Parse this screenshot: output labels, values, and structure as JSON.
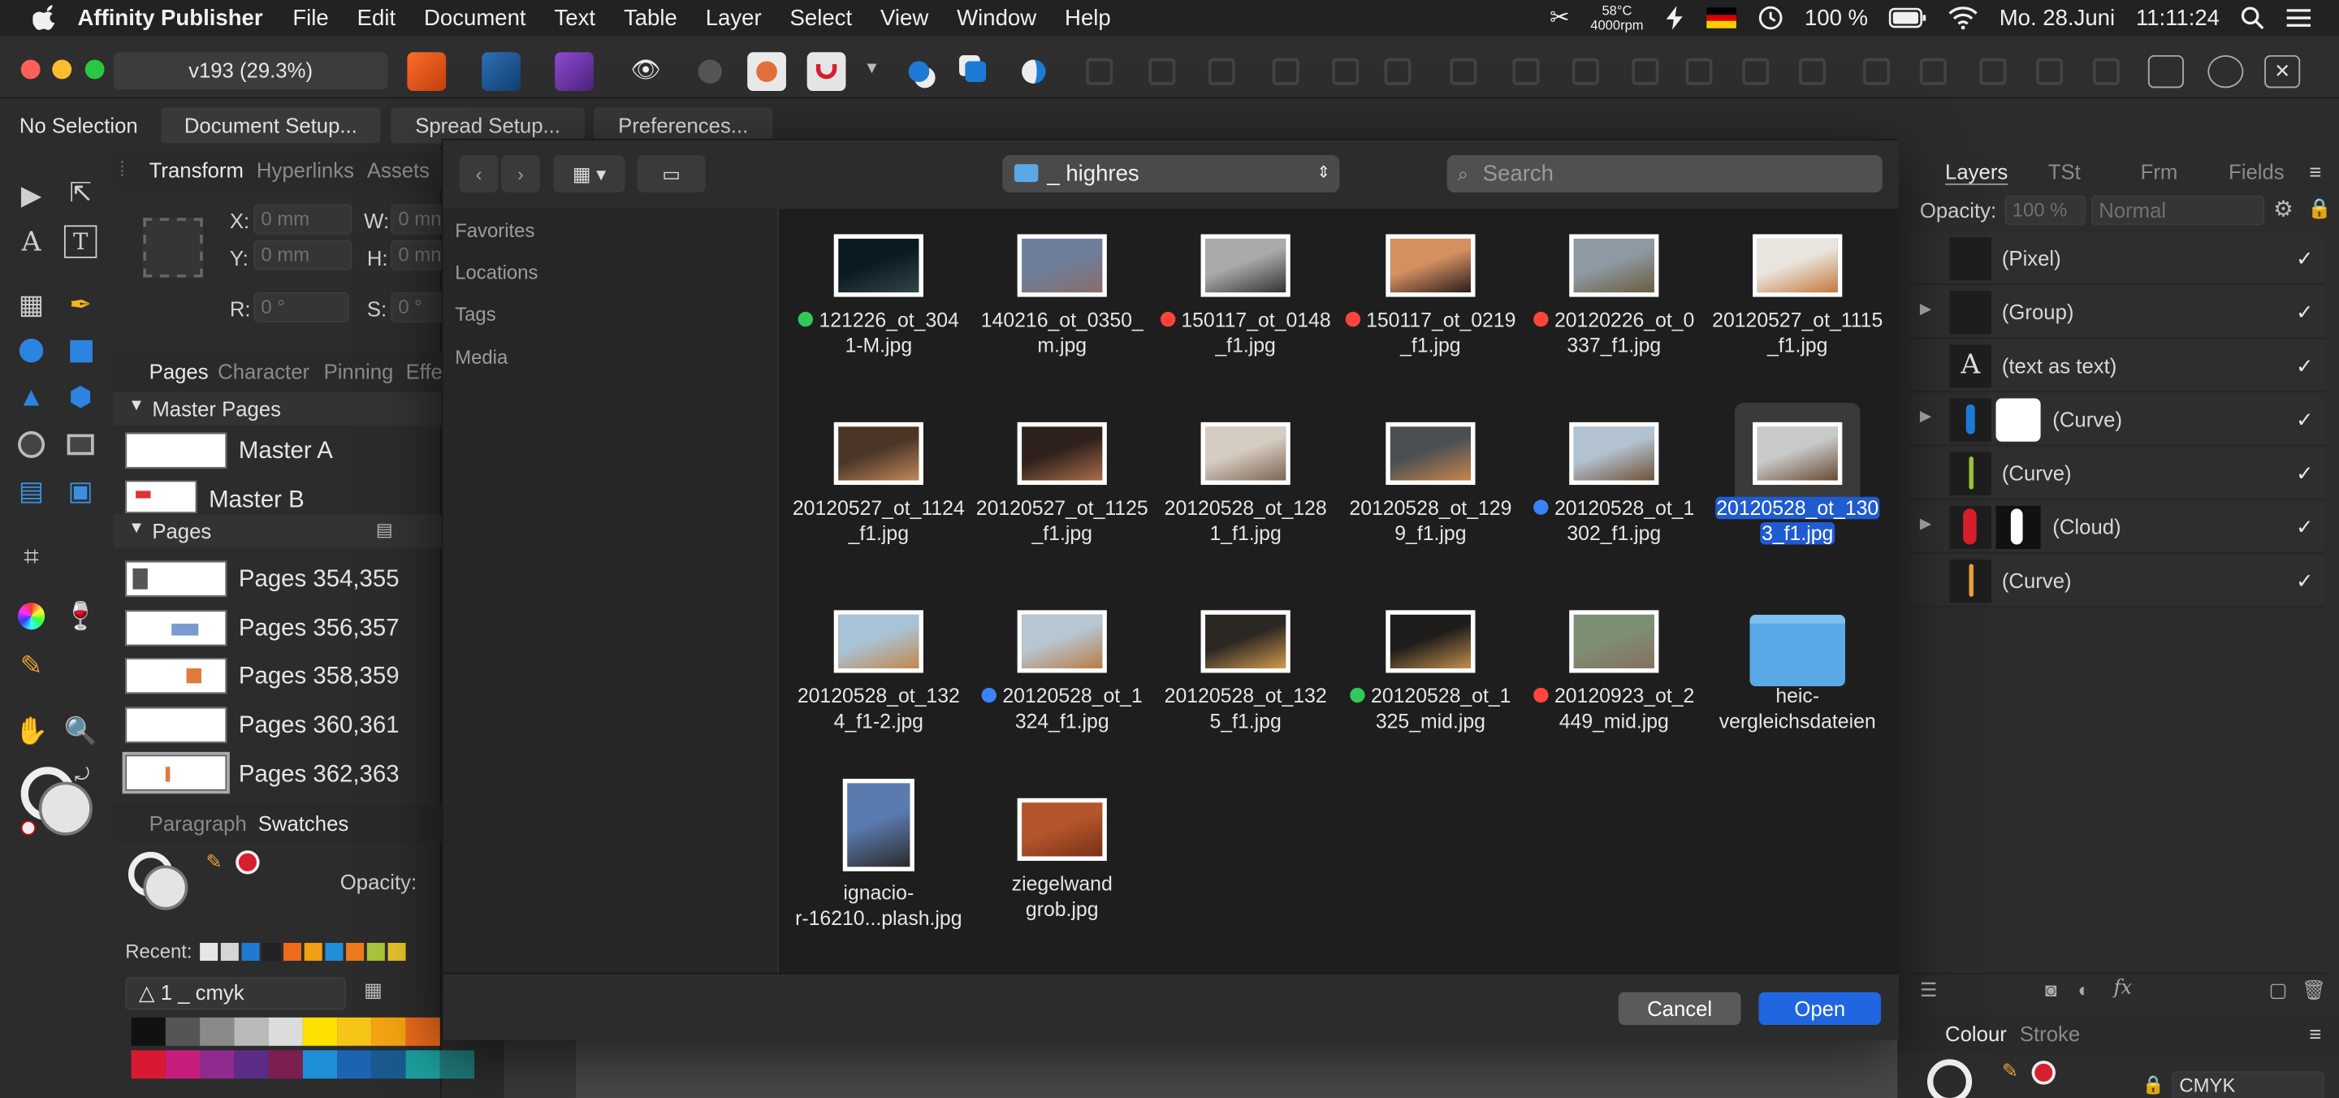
{
  "menubar": {
    "app_name": "Affinity Publisher",
    "menus": [
      "File",
      "Edit",
      "Document",
      "Text",
      "Table",
      "Layer",
      "Select",
      "View",
      "Window",
      "Help"
    ],
    "temperature": "58°C",
    "fan": "4000rpm",
    "battery": "100 %",
    "date": "Mo. 28.Juni",
    "time": "11:11:24"
  },
  "toolbar": {
    "document_title": "v193  (29.3%)"
  },
  "contextbar": {
    "selection": "No Selection",
    "document_setup": "Document Setup...",
    "spread_setup": "Spread Setup...",
    "preferences": "Preferences..."
  },
  "left_studio": {
    "tabs_top": [
      "Transform",
      "Hyperlinks",
      "Assets"
    ],
    "transform": {
      "x_label": "X:",
      "x_value": "0 mm",
      "y_label": "Y:",
      "y_value": "0 mm",
      "w_label": "W:",
      "w_value": "0 mn",
      "h_label": "H:",
      "h_value": "0 mn",
      "r_label": "R:",
      "r_value": "0 °",
      "s_label": "S:",
      "s_value": "0 °"
    },
    "tabs_mid": [
      "Pages",
      "Character",
      "Pinning",
      "Effe"
    ],
    "master_pages_header": "Master Pages",
    "master_pages": [
      "Master A",
      "Master B"
    ],
    "pages_header": "Pages",
    "pages": [
      "Pages 354,355",
      "Pages 356,357",
      "Pages 358,359",
      "Pages 360,361",
      "Pages 362,363"
    ],
    "tabs_bottom": [
      "Paragraph",
      "Swatches"
    ],
    "opacity_label": "Opacity:",
    "recent_label": "Recent:",
    "palette_name": "1 _ cmyk"
  },
  "right_studio": {
    "tabs": [
      "Layers",
      "TSt",
      "Frm",
      "Fields"
    ],
    "opacity_label": "Opacity:",
    "opacity_value": "100 %",
    "blend_mode": "Normal",
    "layers": [
      {
        "name": "(Pixel)",
        "expandable": false,
        "checked": "✓"
      },
      {
        "name": "(Group)",
        "expandable": true,
        "checked": "✓"
      },
      {
        "name": "(text as text)",
        "expandable": false,
        "checked": "✓"
      },
      {
        "name": "(Curve)",
        "expandable": true,
        "checked": "✓"
      },
      {
        "name": "(Curve)",
        "expandable": false,
        "checked": "✓"
      },
      {
        "name": "(Cloud)",
        "expandable": true,
        "checked": "✓"
      },
      {
        "name": "(Curve)",
        "expandable": false,
        "checked": "✓"
      }
    ],
    "bottom_tabs": [
      "Colour",
      "Stroke"
    ],
    "colour_model": "CMYK"
  },
  "dialog": {
    "folder": "_ highres",
    "search_placeholder": "Search",
    "sidebar": [
      "Favorites",
      "Locations",
      "Tags",
      "Media"
    ],
    "files": [
      {
        "line1": "121226_ot_304",
        "line2": "1-M.jpg",
        "tag": "#34c759",
        "colors": [
          "#0b1a22",
          "#31444a"
        ]
      },
      {
        "line1": "140216_ot_0350_",
        "line2": "m.jpg",
        "tag": "",
        "colors": [
          "#6d7f9c",
          "#8a6c6a"
        ]
      },
      {
        "line1": "150117_ot_0148",
        "line2": "_f1.jpg",
        "tag": "#ff453a",
        "colors": [
          "#aaaaaa",
          "#333333"
        ]
      },
      {
        "line1": "150117_ot_0219",
        "line2": "_f1.jpg",
        "tag": "#ff453a",
        "colors": [
          "#d59060",
          "#2a1d1c"
        ]
      },
      {
        "line1": "20120226_ot_0",
        "line2": "337_f1.jpg",
        "tag": "#ff453a",
        "colors": [
          "#8d9aa4",
          "#6b5c3d"
        ]
      },
      {
        "line1": "20120527_ot_1115",
        "line2": "_f1.jpg",
        "tag": "",
        "colors": [
          "#e9e4dd",
          "#c4773b"
        ]
      },
      {
        "line1": "20120527_ot_1124",
        "line2": "_f1.jpg",
        "tag": "",
        "colors": [
          "#4a3526",
          "#c0875d"
        ]
      },
      {
        "line1": "20120527_ot_1125",
        "line2": "_f1.jpg",
        "tag": "",
        "colors": [
          "#2e211b",
          "#a96d4b"
        ]
      },
      {
        "line1": "20120528_ot_128",
        "line2": "1_f1.jpg",
        "tag": "",
        "colors": [
          "#d6cdc2",
          "#7e6554"
        ]
      },
      {
        "line1": "20120528_ot_129",
        "line2": "9_f1.jpg",
        "tag": "",
        "colors": [
          "#4c4f52",
          "#c6864d"
        ]
      },
      {
        "line1": "20120528_ot_1",
        "line2": "302_f1.jpg",
        "tag": "#3b82f6",
        "colors": [
          "#b3c2d1",
          "#6f5136"
        ]
      },
      {
        "line1": "20120528_ot_130",
        "line2": "3_f1.jpg",
        "tag": "",
        "colors": [
          "#c8c9c9",
          "#6a4a32"
        ],
        "selected": true
      },
      {
        "line1": "20120528_ot_132",
        "line2": "4_f1-2.jpg",
        "tag": "",
        "colors": [
          "#a9c3d6",
          "#c2874a"
        ]
      },
      {
        "line1": "20120528_ot_1",
        "line2": "324_f1.jpg",
        "tag": "#3b82f6",
        "colors": [
          "#b7c6d1",
          "#b97c47"
        ]
      },
      {
        "line1": "20120528_ot_132",
        "line2": "5_f1.jpg",
        "tag": "",
        "colors": [
          "#2b2722",
          "#d29a4e"
        ]
      },
      {
        "line1": "20120528_ot_1",
        "line2": "325_mid.jpg",
        "tag": "#34c759",
        "colors": [
          "#1f1d1b",
          "#c48e4d"
        ]
      },
      {
        "line1": "20120923_ot_2",
        "line2": "449_mid.jpg",
        "tag": "#ff453a",
        "colors": [
          "#7d8f73",
          "#857060"
        ]
      },
      {
        "line1": "heic-",
        "line2": "vergleichsdateien",
        "tag": "",
        "folder": true
      },
      {
        "line1": "ignacio-",
        "line2": "r-16210...plash.jpg",
        "tag": "",
        "colors": [
          "#5a7bb0",
          "#2d2b2b"
        ],
        "tall": true
      },
      {
        "line1": "ziegelwand",
        "line2": "grob.jpg",
        "tag": "",
        "colors": [
          "#b4562c",
          "#7a3116"
        ]
      }
    ],
    "cancel": "Cancel",
    "open": "Open"
  },
  "swatch_colors": {
    "row1": [
      "#111111",
      "#555555",
      "#8a8a8a",
      "#b9b9b9",
      "#dcdcdc",
      "#ffe100",
      "#f7c418",
      "#f5a412",
      "#ee6b1b"
    ],
    "row2": [
      "#d71a31",
      "#c71d7c",
      "#8f2a8e",
      "#5b2d88",
      "#7a1f4f",
      "#1f8fd7",
      "#1c64b1",
      "#1a5a8e",
      "#1d9f9f",
      "#1f7a7a"
    ],
    "recent": [
      "#e6e6e6",
      "#d5d5d5",
      "#1f7ad0",
      "#222222",
      "#ee6b1b",
      "#f0a010",
      "#1f8fd7",
      "#ee7b1b",
      "#a9c43a",
      "#e5c22d"
    ]
  }
}
